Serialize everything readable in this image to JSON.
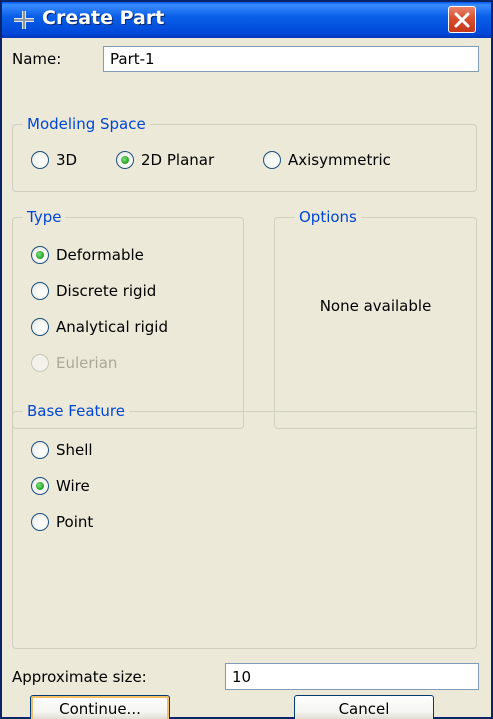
{
  "window": {
    "title": "Create Part",
    "close_symbol": "close-icon",
    "title_icon": "plus-cross-icon"
  },
  "name": {
    "label": "Name:",
    "value": "Part-1"
  },
  "modeling_space": {
    "title": "Modeling Space",
    "options": [
      {
        "label": "3D",
        "checked": false
      },
      {
        "label": "2D Planar",
        "checked": true
      },
      {
        "label": "Axisymmetric",
        "checked": false
      }
    ]
  },
  "type": {
    "title": "Type",
    "options": [
      {
        "label": "Deformable",
        "checked": true,
        "disabled": false
      },
      {
        "label": "Discrete rigid",
        "checked": false,
        "disabled": false
      },
      {
        "label": "Analytical rigid",
        "checked": false,
        "disabled": false
      },
      {
        "label": "Eulerian",
        "checked": false,
        "disabled": true
      }
    ]
  },
  "options_group": {
    "title": "Options",
    "message": "None available"
  },
  "base_feature": {
    "title": "Base Feature",
    "options": [
      {
        "label": "Shell",
        "checked": false
      },
      {
        "label": "Wire",
        "checked": true
      },
      {
        "label": "Point",
        "checked": false
      }
    ]
  },
  "approx_size": {
    "label": "Approximate size:",
    "value": "10"
  },
  "buttons": {
    "continue_label": "Continue...",
    "cancel_label": "Cancel"
  },
  "colors": {
    "title_bar": "#0a5fe8",
    "group_title": "#0046d5",
    "dialog_bg": "#ece9d8",
    "close_button": "#d8502e",
    "radio_checked": "#21a121"
  }
}
